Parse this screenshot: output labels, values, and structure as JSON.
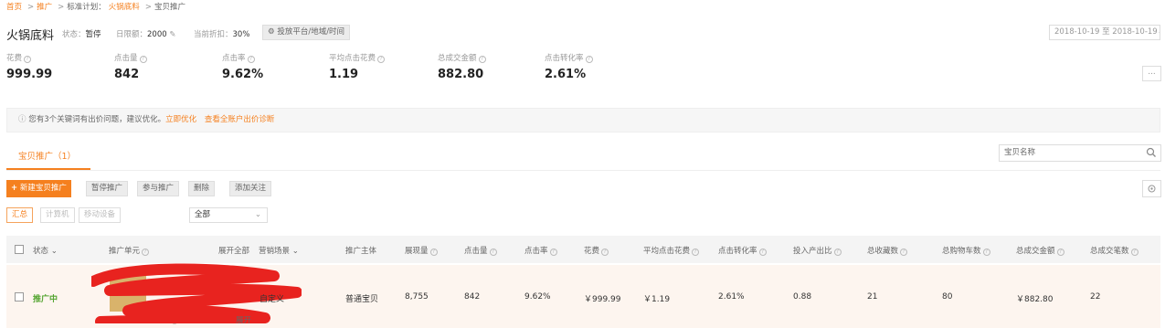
{
  "breadcrumb": {
    "home": "首页",
    "promote": "推广",
    "plan_prefix": "标准计划：",
    "plan_name": "火锅底料",
    "current": "宝贝推广",
    "sep": ">"
  },
  "header": {
    "title": "火锅底料",
    "status_label": "状态：",
    "status_value": "暂停",
    "budget_label": "日限额：",
    "budget_value": "2000",
    "discount_label": "当前折扣：",
    "discount_value": "30%",
    "platform_button": "投放平台/地域/时间",
    "date_range": "2018-10-19 至 2018-10-19"
  },
  "metrics": [
    {
      "label": "花费",
      "value": "999.99"
    },
    {
      "label": "点击量",
      "value": "842"
    },
    {
      "label": "点击率",
      "value": "9.62%"
    },
    {
      "label": "平均点击花费",
      "value": "1.19"
    },
    {
      "label": "总成交金额",
      "value": "882.80"
    },
    {
      "label": "点击转化率",
      "value": "2.61%"
    }
  ],
  "more_button": "...",
  "notice": {
    "text": "您有3个关键词有出价问题，建议优化。",
    "link1": "立即优化",
    "link2": "查看全账户出价诊断"
  },
  "tabs": [
    {
      "label": "宝贝推广（1）"
    }
  ],
  "search": {
    "placeholder": "宝贝名称"
  },
  "toolbar": {
    "new_button": "新建宝贝推广",
    "pause": "暂停推广",
    "join": "参与推广",
    "delete": "删除",
    "follow": "添加关注"
  },
  "device_tabs": [
    "汇总",
    "计算机",
    "移动设备"
  ],
  "filter_select": "全部",
  "table": {
    "headers": {
      "status": "状态",
      "unit": "推广单元",
      "expand_all": "展开全部",
      "scene": "营销场景",
      "subject": "推广主体",
      "impressions": "展现量",
      "clicks": "点击量",
      "ctr": "点击率",
      "cost": "花费",
      "cpc": "平均点击花费",
      "cvr": "点击转化率",
      "roi": "投入产出比",
      "favorites": "总收藏数",
      "carts": "总购物车数",
      "gmv": "总成交金额",
      "orders": "总成交笔数"
    },
    "rows": [
      {
        "status": "推广中",
        "unit_link": "关键词优化>>",
        "scene": "自定义",
        "subject": "普通宝贝",
        "impressions": "8,755",
        "clicks": "842",
        "ctr": "9.62%",
        "cost": "￥999.99",
        "cpc": "￥1.19",
        "cvr": "2.61%",
        "roi": "0.88",
        "favorites": "21",
        "carts": "80",
        "gmv": "￥882.80",
        "orders": "22",
        "expand": "展开"
      }
    ]
  },
  "colors": {
    "accent": "#f5801f",
    "status_active": "#55a532",
    "redaction": "#e8231f"
  }
}
